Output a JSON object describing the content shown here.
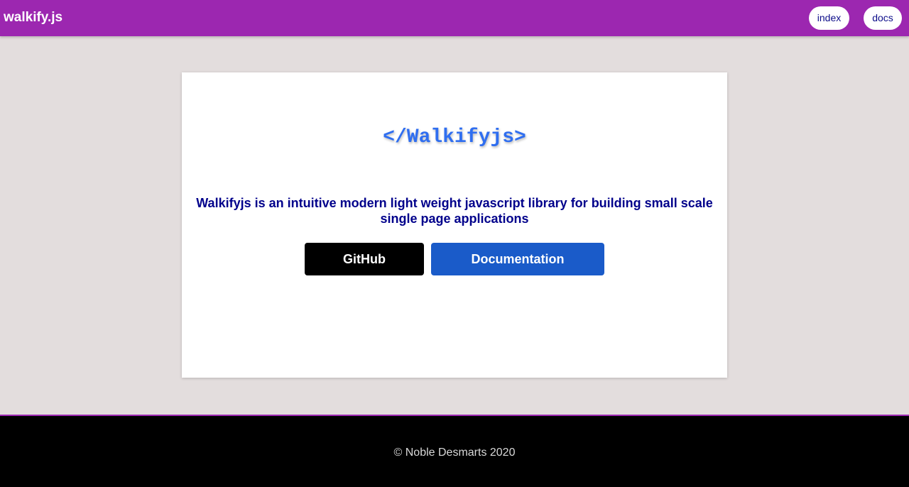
{
  "navbar": {
    "brand": "walkify.js",
    "links": [
      {
        "label": "index"
      },
      {
        "label": "docs"
      }
    ]
  },
  "hero": {
    "logo_text": "</Walkifyjs>",
    "tagline": "Walkifyjs is an intuitive modern light weight javascript library for building small scale single page applications",
    "buttons": {
      "github_label": "GitHub",
      "docs_label": "Documentation"
    }
  },
  "footer": {
    "copyright": "© Noble Desmarts 2020"
  },
  "colors": {
    "navbar_bg": "#9c27b0",
    "page_bg": "#e3dddd",
    "logo": "#2f6ef0",
    "tagline": "#00008b",
    "github_button": "#000000",
    "docs_button": "#1a5bc9",
    "footer_bg": "#000000"
  }
}
